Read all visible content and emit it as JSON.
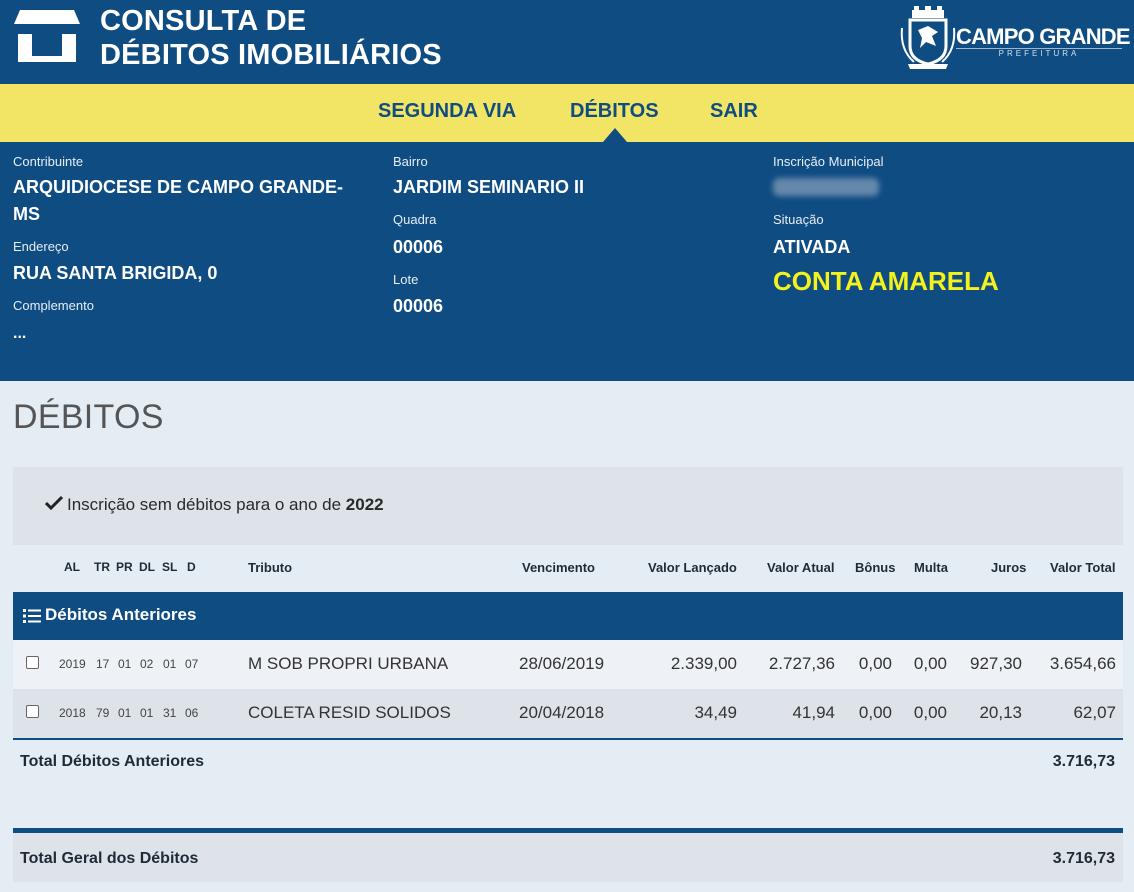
{
  "header": {
    "title_line1": "CONSULTA DE",
    "title_line2": "DÉBITOS IMOBILIÁRIOS",
    "logo_name": "CAMPO GRANDE",
    "logo_sub": "PREFEITURA",
    "brand_color": "#0f4c82",
    "icon": "store-icon"
  },
  "nav": {
    "items": [
      "SEGUNDA VIA",
      "DÉBITOS",
      "SAIR"
    ],
    "active": "DÉBITOS",
    "accent_color": "#f2e465"
  },
  "info": {
    "contribuinte_label": "Contribuinte",
    "contribuinte_line1": "ARQUIDIOCESE DE CAMPO GRANDE-",
    "contribuinte_line2": "MS",
    "endereco_label": "Endereço",
    "endereco": "RUA SANTA BRIGIDA, 0",
    "complemento_label": "Complemento",
    "complemento": "...",
    "bairro_label": "Bairro",
    "bairro": "JARDIM SEMINARIO II",
    "quadra_label": "Quadra",
    "quadra": "00006",
    "lote_label": "Lote",
    "lote": "00006",
    "inscricao_label": "Inscrição Municipal",
    "situacao_label": "Situação",
    "situacao": "ATIVADA",
    "alerta": "CONTA AMARELA"
  },
  "debitos": {
    "title": "DÉBITOS",
    "notice_prefix": "Inscrição sem débitos para o ano de ",
    "notice_year": "2022",
    "columns": {
      "al": "AL",
      "tr": "TR",
      "pr": "PR",
      "dl": "DL",
      "sl": "SL",
      "d": "D",
      "tributo": "Tributo",
      "vencimento": "Vencimento",
      "valor_lancado": "Valor Lançado",
      "valor_atual": "Valor Atual",
      "bonus": "Bônus",
      "multa": "Multa",
      "juros": "Juros",
      "valor_total": "Valor Total"
    },
    "group_label": "Débitos Anteriores",
    "rows": [
      {
        "al": "2019",
        "tr": "17",
        "pr": "01",
        "dl": "02",
        "sl": "01",
        "d": "07",
        "tributo": "M SOB PROPRI URBANA",
        "vencimento": "28/06/2019",
        "valor_lancado": "2.339,00",
        "valor_atual": "2.727,36",
        "bonus": "0,00",
        "multa": "0,00",
        "juros": "927,30",
        "valor_total": "3.654,66"
      },
      {
        "al": "2018",
        "tr": "79",
        "pr": "01",
        "dl": "01",
        "sl": "31",
        "d": "06",
        "tributo": "COLETA RESID SOLIDOS",
        "vencimento": "20/04/2018",
        "valor_lancado": "34,49",
        "valor_atual": "41,94",
        "bonus": "0,00",
        "multa": "0,00",
        "juros": "20,13",
        "valor_total": "62,07"
      }
    ],
    "total_anteriores_label": "Total Débitos Anteriores",
    "total_anteriores": "3.716,73",
    "total_geral_label": "Total Geral dos Débitos",
    "total_geral": "3.716,73"
  }
}
